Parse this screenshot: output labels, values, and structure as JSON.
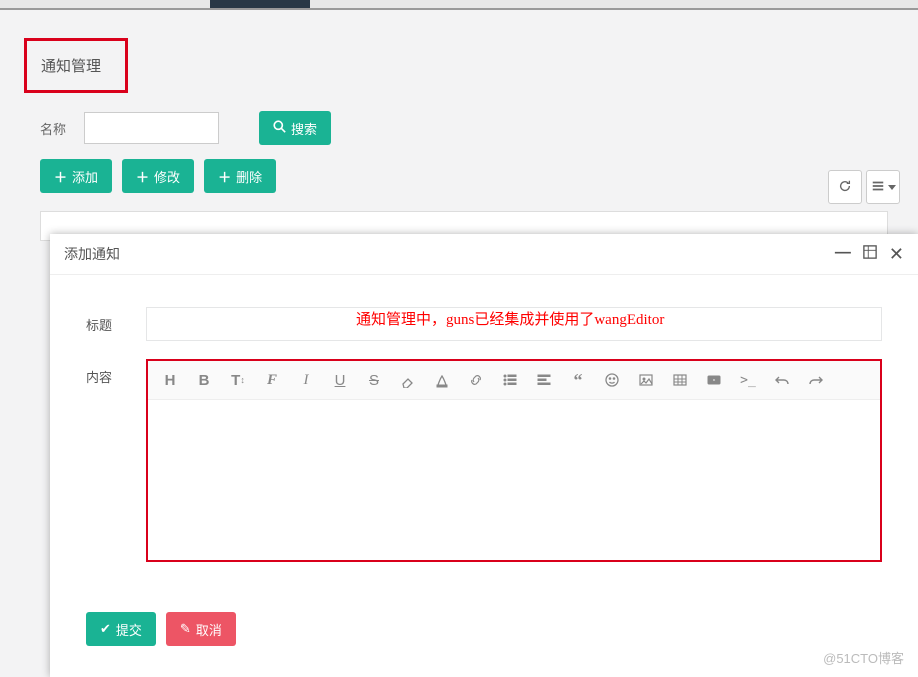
{
  "page": {
    "title": "通知管理"
  },
  "search": {
    "label": "名称",
    "placeholder": "",
    "button": "搜索"
  },
  "actions": {
    "add": "添加",
    "edit": "修改",
    "delete": "删除"
  },
  "modal": {
    "title": "添加通知",
    "form": {
      "title_label": "标题",
      "title_value": "",
      "content_label": "内容"
    },
    "note": "通知管理中，guns已经集成并使用了wangEditor",
    "submit": "提交",
    "cancel": "取消"
  },
  "editor_toolbar": {
    "heading": "H",
    "bold": "B",
    "fontsize": "T",
    "fontfamily": "F",
    "italic": "I",
    "underline": "U",
    "strike": "S"
  },
  "watermark": "@51CTO博客"
}
